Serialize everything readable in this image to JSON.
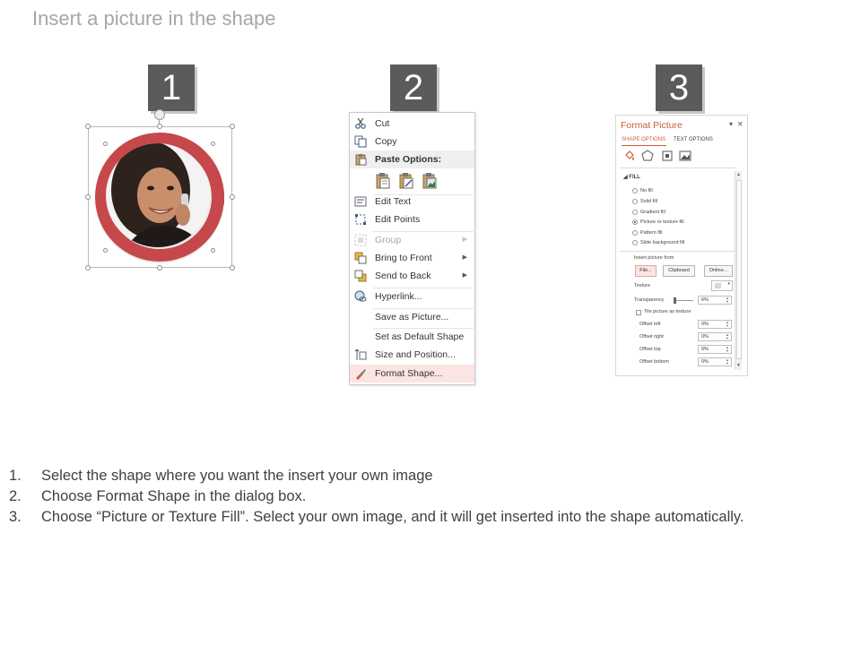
{
  "slide": {
    "title": "Insert a picture in the shape"
  },
  "steps": [
    "1",
    "2",
    "3"
  ],
  "colors": {
    "accent_red": "#c7484a",
    "step_box": "#5b5b5b",
    "title_gray": "#a6a6a6",
    "pane_accent": "#d05a3c"
  },
  "context_menu": {
    "items": [
      {
        "label": "Cut",
        "icon": "scissors-icon"
      },
      {
        "label": "Copy",
        "icon": "copy-icon"
      },
      {
        "label": "Paste Options:",
        "icon": "clipboard-icon"
      },
      {
        "label": "Edit Text",
        "icon": "edit-text-icon"
      },
      {
        "label": "Edit Points",
        "icon": "edit-points-icon"
      },
      {
        "label": "Group",
        "icon": "group-icon"
      },
      {
        "label": "Bring to Front",
        "icon": "bring-front-icon"
      },
      {
        "label": "Send to Back",
        "icon": "send-back-icon"
      },
      {
        "label": "Hyperlink...",
        "icon": "hyperlink-icon"
      },
      {
        "label": "Save as Picture...",
        "icon": ""
      },
      {
        "label": "Set as Default Shape",
        "icon": ""
      },
      {
        "label": "Size and Position...",
        "icon": "size-position-icon"
      },
      {
        "label": "Format Shape...",
        "icon": "format-shape-icon"
      }
    ]
  },
  "format_pane": {
    "title": "Format Picture",
    "tabs": [
      "SHAPE OPTIONS",
      "TEXT OPTIONS"
    ],
    "section": "FILL",
    "fill_options": [
      "No fill",
      "Solid fill",
      "Gradient fill",
      "Picture or texture fill",
      "Pattern fill",
      "Slide background fill"
    ],
    "selected_fill": "Picture or texture fill",
    "insert_from_label": "Insert picture from",
    "buttons": [
      "File...",
      "Clipboard",
      "Online..."
    ],
    "texture_label": "Texture",
    "transparency_label": "Transparency",
    "transparency_value": "6%",
    "tile_label": "Tile picture as texture",
    "offsets": [
      {
        "label": "Offset left",
        "value": "0%"
      },
      {
        "label": "Offset right",
        "value": "0%"
      },
      {
        "label": "Offset top",
        "value": "0%"
      },
      {
        "label": "Offset bottom",
        "value": "0%"
      }
    ]
  },
  "instructions": [
    {
      "num": "1.",
      "text": "Select the shape where you want the insert your own image"
    },
    {
      "num": "2.",
      "text": "Choose Format Shape in the dialog box."
    },
    {
      "num": "3.",
      "text": "Choose “Picture or Texture Fill”. Select your own image, and it will get inserted into the shape automatically."
    }
  ]
}
